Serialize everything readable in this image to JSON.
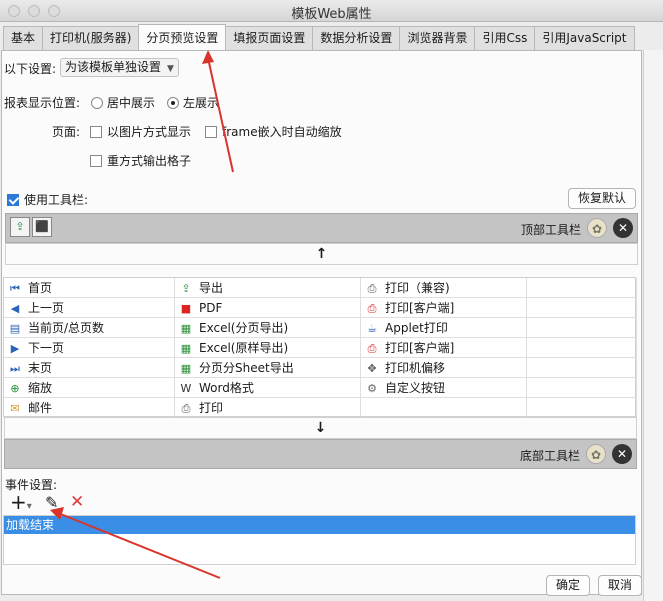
{
  "window": {
    "title": "模板Web属性"
  },
  "tabs": [
    {
      "label": "基本"
    },
    {
      "label": "打印机(服务器)"
    },
    {
      "label": "分页预览设置",
      "active": true
    },
    {
      "label": "填报页面设置"
    },
    {
      "label": "数据分析设置"
    },
    {
      "label": "浏览器背景"
    },
    {
      "label": "引用Css"
    },
    {
      "label": "引用JavaScript"
    }
  ],
  "settings": {
    "label": "以下设置:",
    "value": "为该模板单独设置",
    "report_position_label": "报表显示位置:",
    "radio_center": "居中展示",
    "radio_left": "左展示",
    "radio_selected": "left",
    "page_label": "页面:",
    "cb_image": "以图片方式显示",
    "cb_frame": "frame嵌入时自动缩放",
    "cb_redo": "重方式输出格子"
  },
  "toolbar": {
    "use_label": "使用工具栏:",
    "use_checked": true,
    "restore_default": "恢复默认",
    "top_label": "顶部工具栏",
    "bottom_label": "底部工具栏",
    "up_arrow": "↑",
    "down_arrow": "↓",
    "top_icons": [
      "export-icon",
      "pdf-icon"
    ]
  },
  "grid": [
    [
      {
        "icon": "first-page-icon",
        "label": "首页"
      },
      {
        "icon": "export-icon",
        "label": "导出"
      },
      {
        "icon": "printer-icon",
        "label": "打印（兼容)"
      }
    ],
    [
      {
        "icon": "prev-page-icon",
        "label": "上一页"
      },
      {
        "icon": "pdf-icon",
        "label": "PDF"
      },
      {
        "icon": "pdf-print-icon",
        "label": "打印[客户端]"
      }
    ],
    [
      {
        "icon": "page-count-icon",
        "label": "当前页/总页数"
      },
      {
        "icon": "excel-icon",
        "label": "Excel(分页导出)"
      },
      {
        "icon": "applet-icon",
        "label": "Applet打印"
      }
    ],
    [
      {
        "icon": "next-page-icon",
        "label": "下一页"
      },
      {
        "icon": "excel-icon",
        "label": "Excel(原样导出)"
      },
      {
        "icon": "pdf-print-icon",
        "label": "打印[客户端]"
      }
    ],
    [
      {
        "icon": "last-page-icon",
        "label": "末页"
      },
      {
        "icon": "excel-icon",
        "label": "分页分Sheet导出"
      },
      {
        "icon": "move-icon",
        "label": "打印机偏移"
      }
    ],
    [
      {
        "icon": "zoom-icon",
        "label": "缩放"
      },
      {
        "icon": "word-icon",
        "label": "Word格式"
      },
      {
        "icon": "gear-icon",
        "label": "自定义按钮"
      }
    ],
    [
      {
        "icon": "mail-icon",
        "label": "邮件"
      },
      {
        "icon": "printer-icon",
        "label": "打印"
      },
      {
        "icon": "",
        "label": ""
      }
    ]
  ],
  "events": {
    "label": "事件设置:",
    "add": "+",
    "add_dropdown": "▾",
    "edit": "✎",
    "delete": "✕",
    "items": [
      "加载结束"
    ]
  },
  "footer": {
    "ok": "确定",
    "cancel": "取消"
  },
  "colors": {
    "selection": "#3a8ee6",
    "delete": "#e03a3a",
    "annotation_arrow": "#d9342b"
  }
}
